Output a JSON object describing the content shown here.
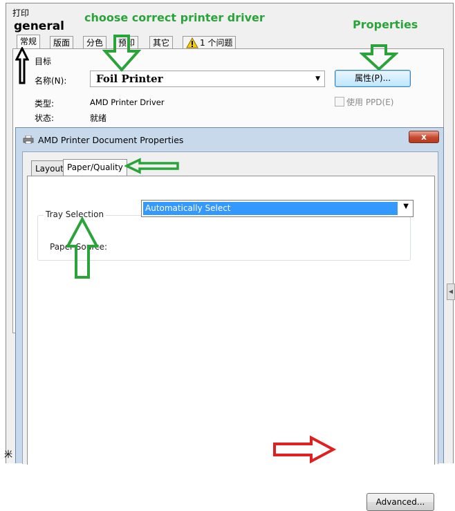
{
  "print_dialog": {
    "title": "打印",
    "tabs": [
      "常规",
      "版面",
      "分色",
      "预印",
      "其它",
      "1 个问题"
    ],
    "target_group": "目标",
    "name_label": "名称(N):",
    "printer_name": "Foil Printer",
    "properties_button": "属性(P)...",
    "type_label": "类型:",
    "type_value": "AMD Printer Driver",
    "status_label": "状态:",
    "status_value": "就绪",
    "use_ppd": "使用 PPD(E)",
    "edge_text": "米"
  },
  "properties_window": {
    "title": "AMD Printer Document Properties",
    "close_label": "x",
    "tabs": [
      "Layout",
      "Paper/Quality"
    ],
    "active_tab": "Paper/Quality",
    "tray_selection": "Tray Selection",
    "paper_source_label": "Paper Source:",
    "paper_source_value": "Automatically Select",
    "advanced_button": "Advanced..."
  },
  "annotations": {
    "general": "general",
    "choose_driver": "choose correct  printer driver",
    "properties": "Properties"
  },
  "colors": {
    "annotation_green": "#2aa43a",
    "annotation_red": "#e02020",
    "selection_blue": "#3399ff"
  }
}
